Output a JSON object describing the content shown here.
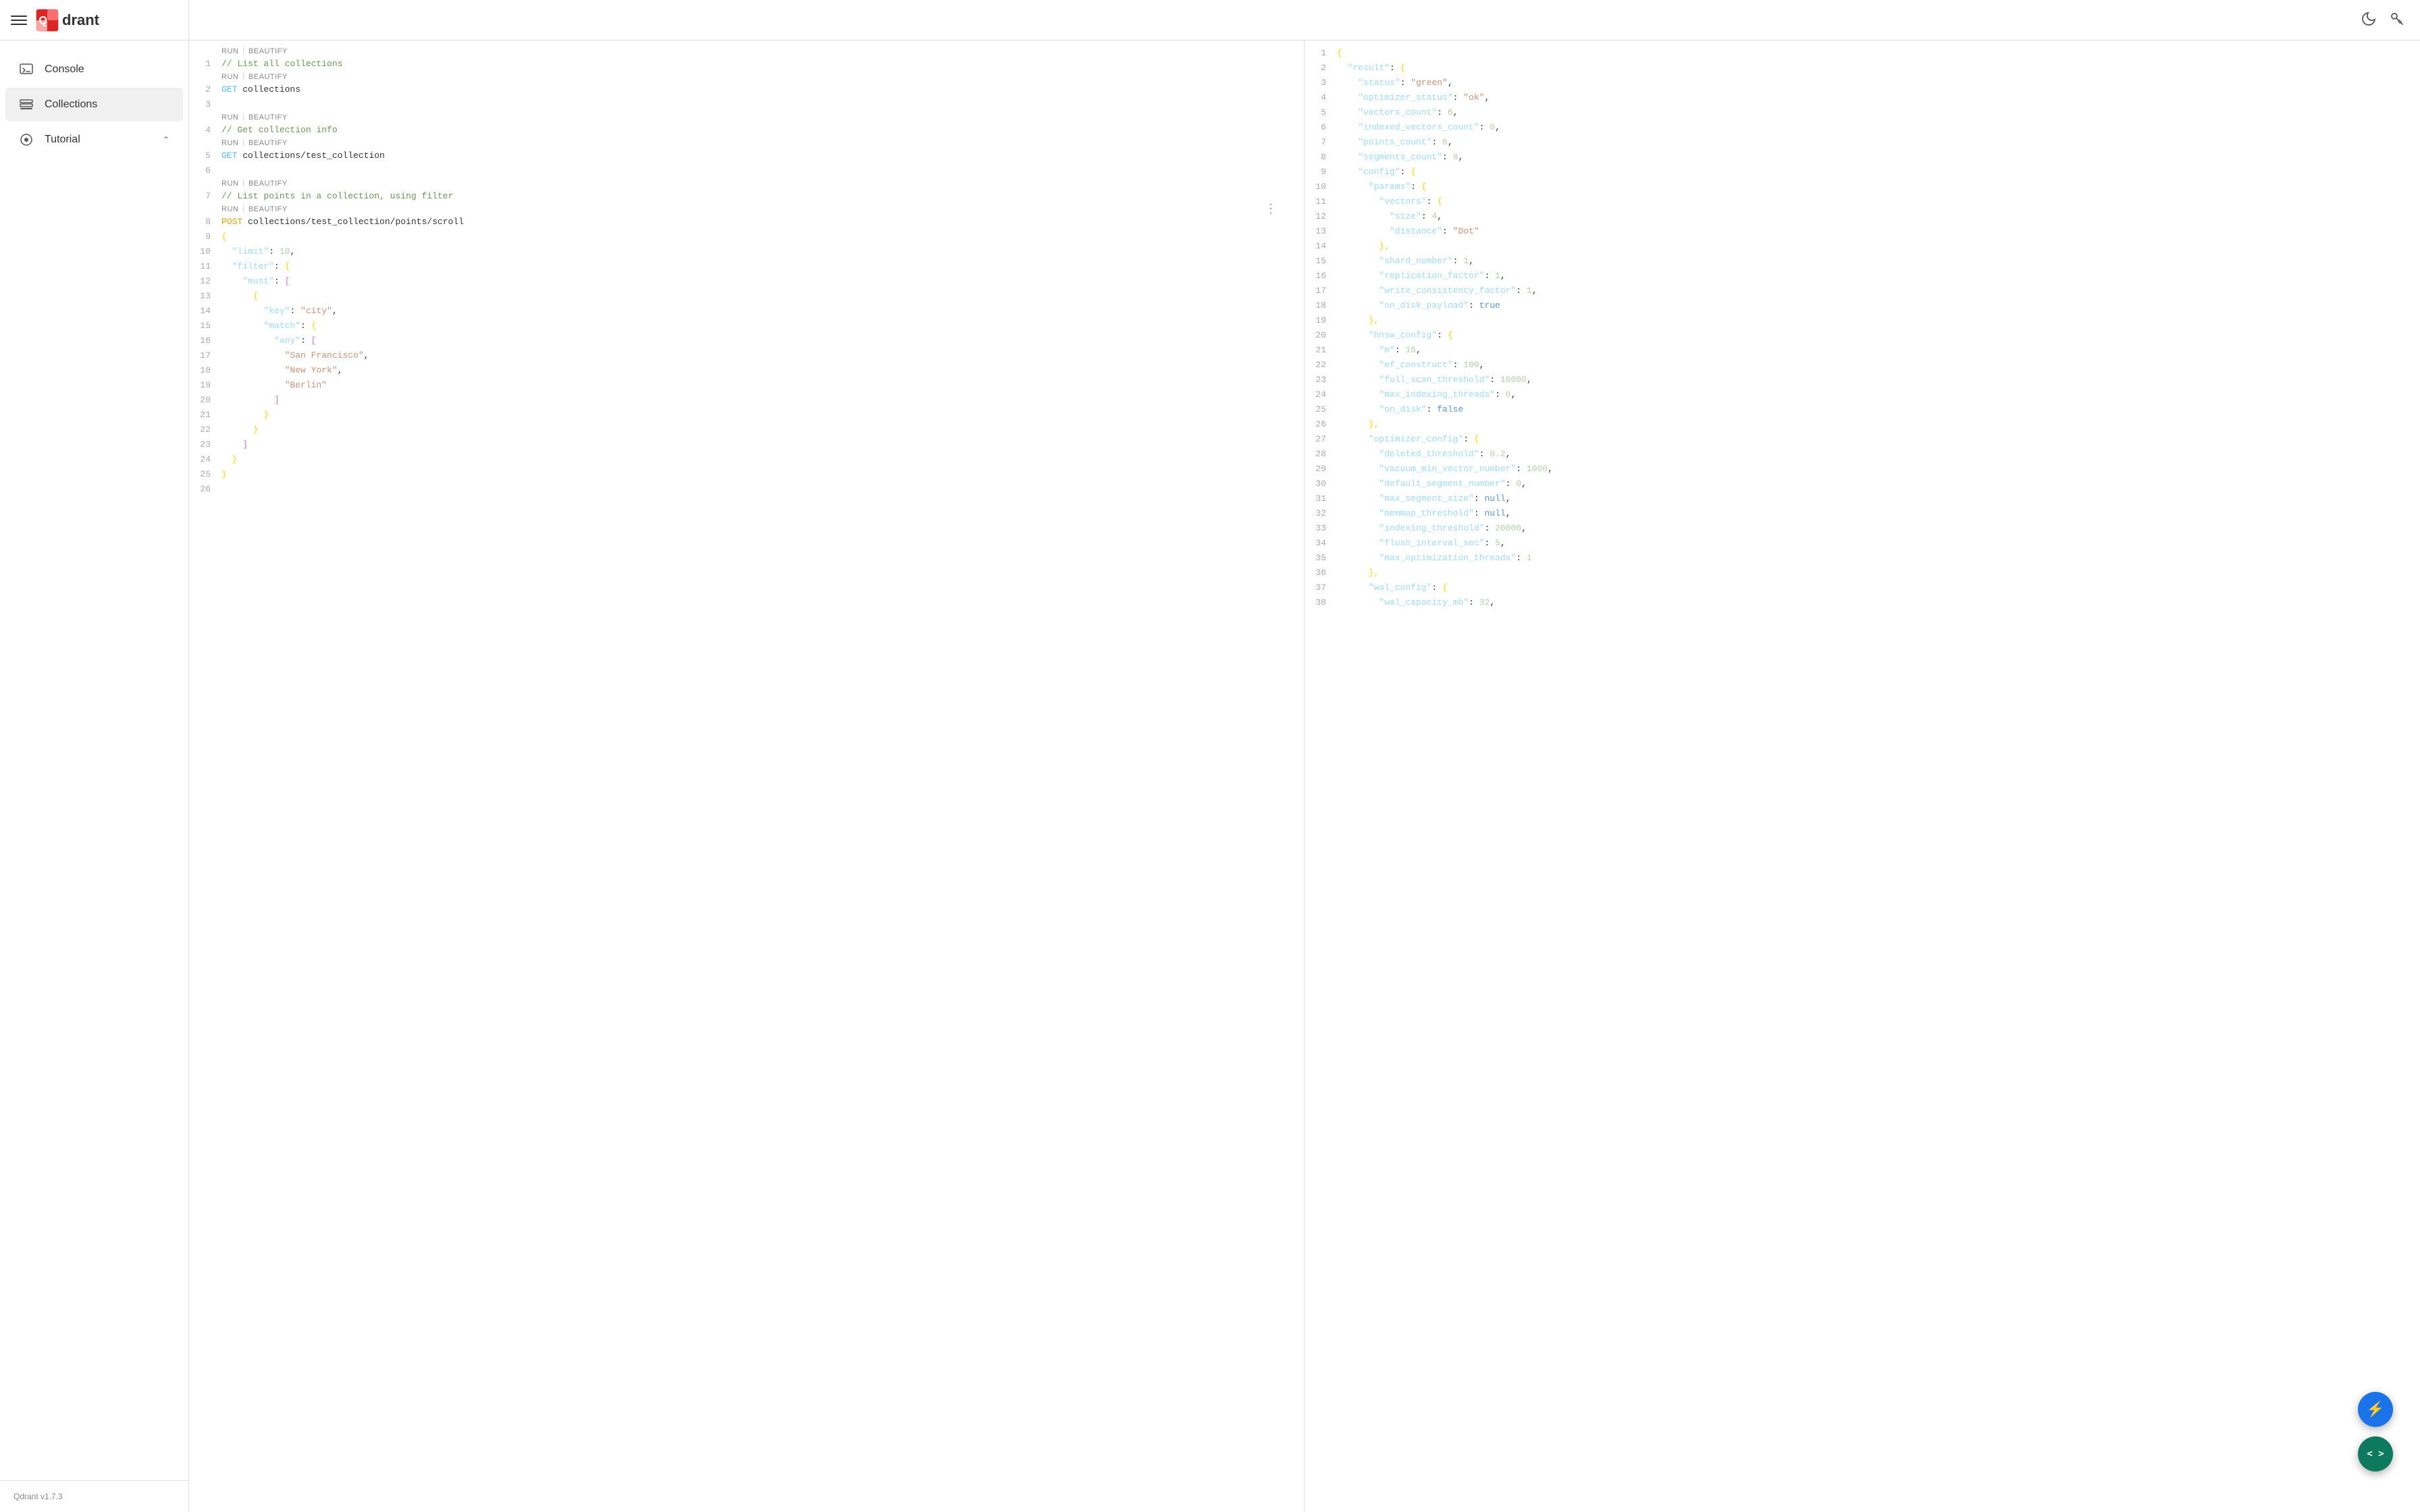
{
  "app": {
    "version": "Qdrant v1.7.3",
    "logo_text": "drant"
  },
  "sidebar": {
    "items": [
      {
        "id": "console",
        "label": "Console",
        "icon": "console-icon"
      },
      {
        "id": "collections",
        "label": "Collections",
        "icon": "collections-icon",
        "active": true
      },
      {
        "id": "tutorial",
        "label": "Tutorial",
        "icon": "tutorial-icon",
        "has_chevron": true
      }
    ]
  },
  "topbar": {
    "theme_icon": "moon",
    "key_icon": "key"
  },
  "code_editor": {
    "blocks": [
      {
        "run_label": "RUN",
        "beautify_label": "BEAUTIFY",
        "lines": [
          {
            "num": 1,
            "content": "// List all collections",
            "type": "comment"
          }
        ]
      },
      {
        "run_label": "RUN",
        "beautify_label": "BEAUTIFY",
        "lines": [
          {
            "num": 2,
            "content": "GET collections",
            "type": "get"
          }
        ]
      },
      {
        "lines": [
          {
            "num": 3,
            "content": "",
            "type": "empty"
          }
        ]
      },
      {
        "run_label": "RUN",
        "beautify_label": "BEAUTIFY",
        "lines": [
          {
            "num": 4,
            "content": "// Get collection info",
            "type": "comment"
          }
        ]
      },
      {
        "run_label": "RUN",
        "beautify_label": "BEAUTIFY",
        "lines": [
          {
            "num": 5,
            "content": "GET collections/test_collection",
            "type": "get"
          }
        ]
      },
      {
        "lines": [
          {
            "num": 6,
            "content": "",
            "type": "empty"
          }
        ]
      },
      {
        "run_label": "RUN",
        "beautify_label": "BEAUTIFY",
        "lines": [
          {
            "num": 7,
            "content": "// List points in a collection, using filter",
            "type": "comment"
          }
        ]
      },
      {
        "run_label": "RUN",
        "beautify_label": "BEAUTIFY",
        "lines": [
          {
            "num": 8,
            "content": "POST collections/test_collection/points/scroll",
            "type": "post"
          },
          {
            "num": 9,
            "content": "{",
            "type": "brace"
          },
          {
            "num": 10,
            "content": "  \"limit\": 10,",
            "type": "body"
          },
          {
            "num": 11,
            "content": "  \"filter\": {",
            "type": "body"
          },
          {
            "num": 12,
            "content": "    \"must\": [",
            "type": "body"
          },
          {
            "num": 13,
            "content": "      {",
            "type": "body"
          },
          {
            "num": 14,
            "content": "        \"key\": \"city\",",
            "type": "body"
          },
          {
            "num": 15,
            "content": "        \"match\": {",
            "type": "body"
          },
          {
            "num": 16,
            "content": "          \"any\": [",
            "type": "body"
          },
          {
            "num": 17,
            "content": "            \"San Francisco\",",
            "type": "body"
          },
          {
            "num": 18,
            "content": "            \"New York\",",
            "type": "body"
          },
          {
            "num": 19,
            "content": "            \"Berlin\"",
            "type": "body"
          },
          {
            "num": 20,
            "content": "          ]",
            "type": "body"
          },
          {
            "num": 21,
            "content": "        }",
            "type": "body"
          },
          {
            "num": 22,
            "content": "      }",
            "type": "body"
          },
          {
            "num": 23,
            "content": "    ]",
            "type": "body"
          },
          {
            "num": 24,
            "content": "  }",
            "type": "body"
          },
          {
            "num": 25,
            "content": "}",
            "type": "brace"
          },
          {
            "num": 26,
            "content": "",
            "type": "empty"
          }
        ]
      }
    ]
  },
  "output": {
    "lines": [
      {
        "num": 1,
        "text": "{"
      },
      {
        "num": 2,
        "text": "  \"result\": {"
      },
      {
        "num": 3,
        "text": "    \"status\": \"green\","
      },
      {
        "num": 4,
        "text": "    \"optimizer_status\": \"ok\","
      },
      {
        "num": 5,
        "text": "    \"vectors_count\": 6,"
      },
      {
        "num": 6,
        "text": "    \"indexed_vectors_count\": 0,"
      },
      {
        "num": 7,
        "text": "    \"points_count\": 6,"
      },
      {
        "num": 8,
        "text": "    \"segments_count\": 8,"
      },
      {
        "num": 9,
        "text": "    \"config\": {"
      },
      {
        "num": 10,
        "text": "      \"params\": {"
      },
      {
        "num": 11,
        "text": "        \"vectors\": {"
      },
      {
        "num": 12,
        "text": "          \"size\": 4,"
      },
      {
        "num": 13,
        "text": "          \"distance\": \"Dot\""
      },
      {
        "num": 14,
        "text": "        },"
      },
      {
        "num": 15,
        "text": "        \"shard_number\": 1,"
      },
      {
        "num": 16,
        "text": "        \"replication_factor\": 1,"
      },
      {
        "num": 17,
        "text": "        \"write_consistency_factor\": 1,"
      },
      {
        "num": 18,
        "text": "        \"on_disk_payload\": true"
      },
      {
        "num": 19,
        "text": "      },"
      },
      {
        "num": 20,
        "text": "      \"hnsw_config\": {"
      },
      {
        "num": 21,
        "text": "        \"m\": 16,"
      },
      {
        "num": 22,
        "text": "        \"ef_construct\": 100,"
      },
      {
        "num": 23,
        "text": "        \"full_scan_threshold\": 10000,"
      },
      {
        "num": 24,
        "text": "        \"max_indexing_threads\": 0,"
      },
      {
        "num": 25,
        "text": "        \"on_disk\": false"
      },
      {
        "num": 26,
        "text": "      },"
      },
      {
        "num": 27,
        "text": "      \"optimizer_config\": {"
      },
      {
        "num": 28,
        "text": "        \"deleted_threshold\": 0.2,"
      },
      {
        "num": 29,
        "text": "        \"vacuum_min_vector_number\": 1000,"
      },
      {
        "num": 30,
        "text": "        \"default_segment_number\": 0,"
      },
      {
        "num": 31,
        "text": "        \"max_segment_size\": null,"
      },
      {
        "num": 32,
        "text": "        \"memmap_threshold\": null,"
      },
      {
        "num": 33,
        "text": "        \"indexing_threshold\": 20000,"
      },
      {
        "num": 34,
        "text": "        \"flush_interval_sec\": 5,"
      },
      {
        "num": 35,
        "text": "        \"max_optimization_threads\": 1"
      },
      {
        "num": 36,
        "text": "      },"
      },
      {
        "num": 37,
        "text": "      \"wal_config\": {"
      },
      {
        "num": 38,
        "text": "        \"wal_capacity_mb\": 32,"
      }
    ]
  },
  "fab": {
    "lightning_label": "⚡",
    "code_label": "< >"
  }
}
